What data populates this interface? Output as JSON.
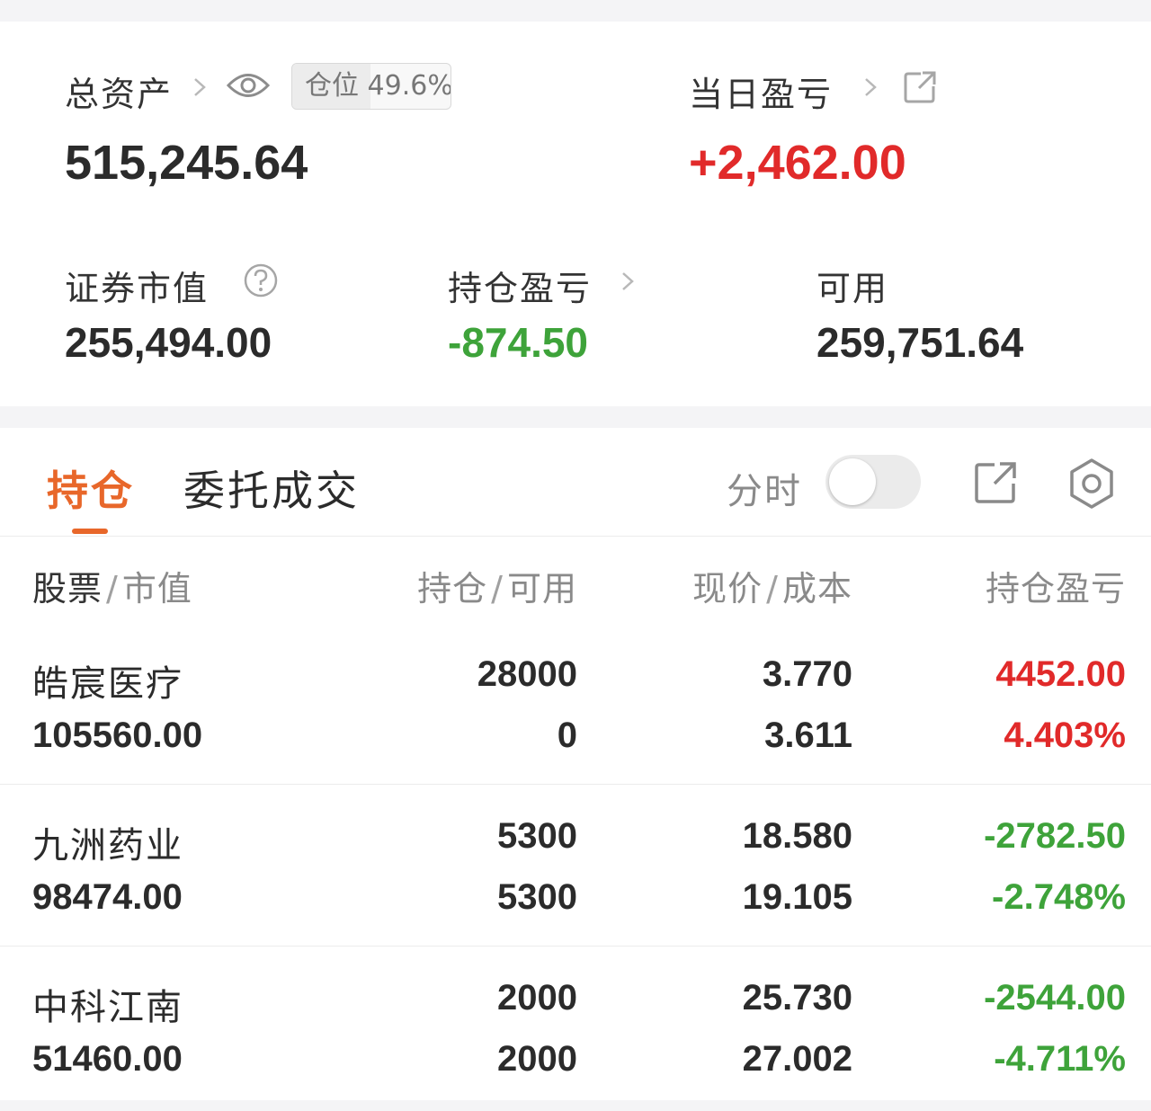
{
  "summary": {
    "total_assets_label": "总资产",
    "total_assets_value": "515,245.64",
    "position_badge_text": "仓位 49.6%",
    "position_ratio": 0.496,
    "daily_pl_label": "当日盈亏",
    "daily_pl_value": "+2,462.00",
    "securities_value_label": "证券市值",
    "securities_value": "255,494.00",
    "holding_pl_label": "持仓盈亏",
    "holding_pl_value": "-874.50",
    "available_label": "可用",
    "available_value": "259,751.64"
  },
  "tabs": {
    "active": "持仓",
    "other": "委托成交",
    "timeshare_label": "分时",
    "timeshare_on": false
  },
  "table": {
    "headers": {
      "stock": "股票",
      "market_value": "市值",
      "holding": "持仓",
      "available": "可用",
      "price": "现价",
      "cost": "成本",
      "pl": "持仓盈亏"
    },
    "rows": [
      {
        "name": "皓宸医疗",
        "market_value": "105560.00",
        "holding": "28000",
        "available": "0",
        "price": "3.770",
        "cost": "3.611",
        "pl": "4452.00",
        "pl_pct": "4.403%"
      },
      {
        "name": "九洲药业",
        "market_value": "98474.00",
        "holding": "5300",
        "available": "5300",
        "price": "18.580",
        "cost": "19.105",
        "pl": "-2782.50",
        "pl_pct": "-2.748%"
      },
      {
        "name": "中科江南",
        "market_value": "51460.00",
        "holding": "2000",
        "available": "2000",
        "price": "25.730",
        "cost": "27.002",
        "pl": "-2544.00",
        "pl_pct": "-4.711%"
      }
    ]
  },
  "colors": {
    "up": "#e12a2a",
    "down": "#3ea33a",
    "accent": "#e8672a"
  },
  "icons": [
    "chevron-right-icon",
    "eye-icon",
    "external-link-icon",
    "help-circle-icon",
    "share-icon",
    "gear-icon"
  ]
}
